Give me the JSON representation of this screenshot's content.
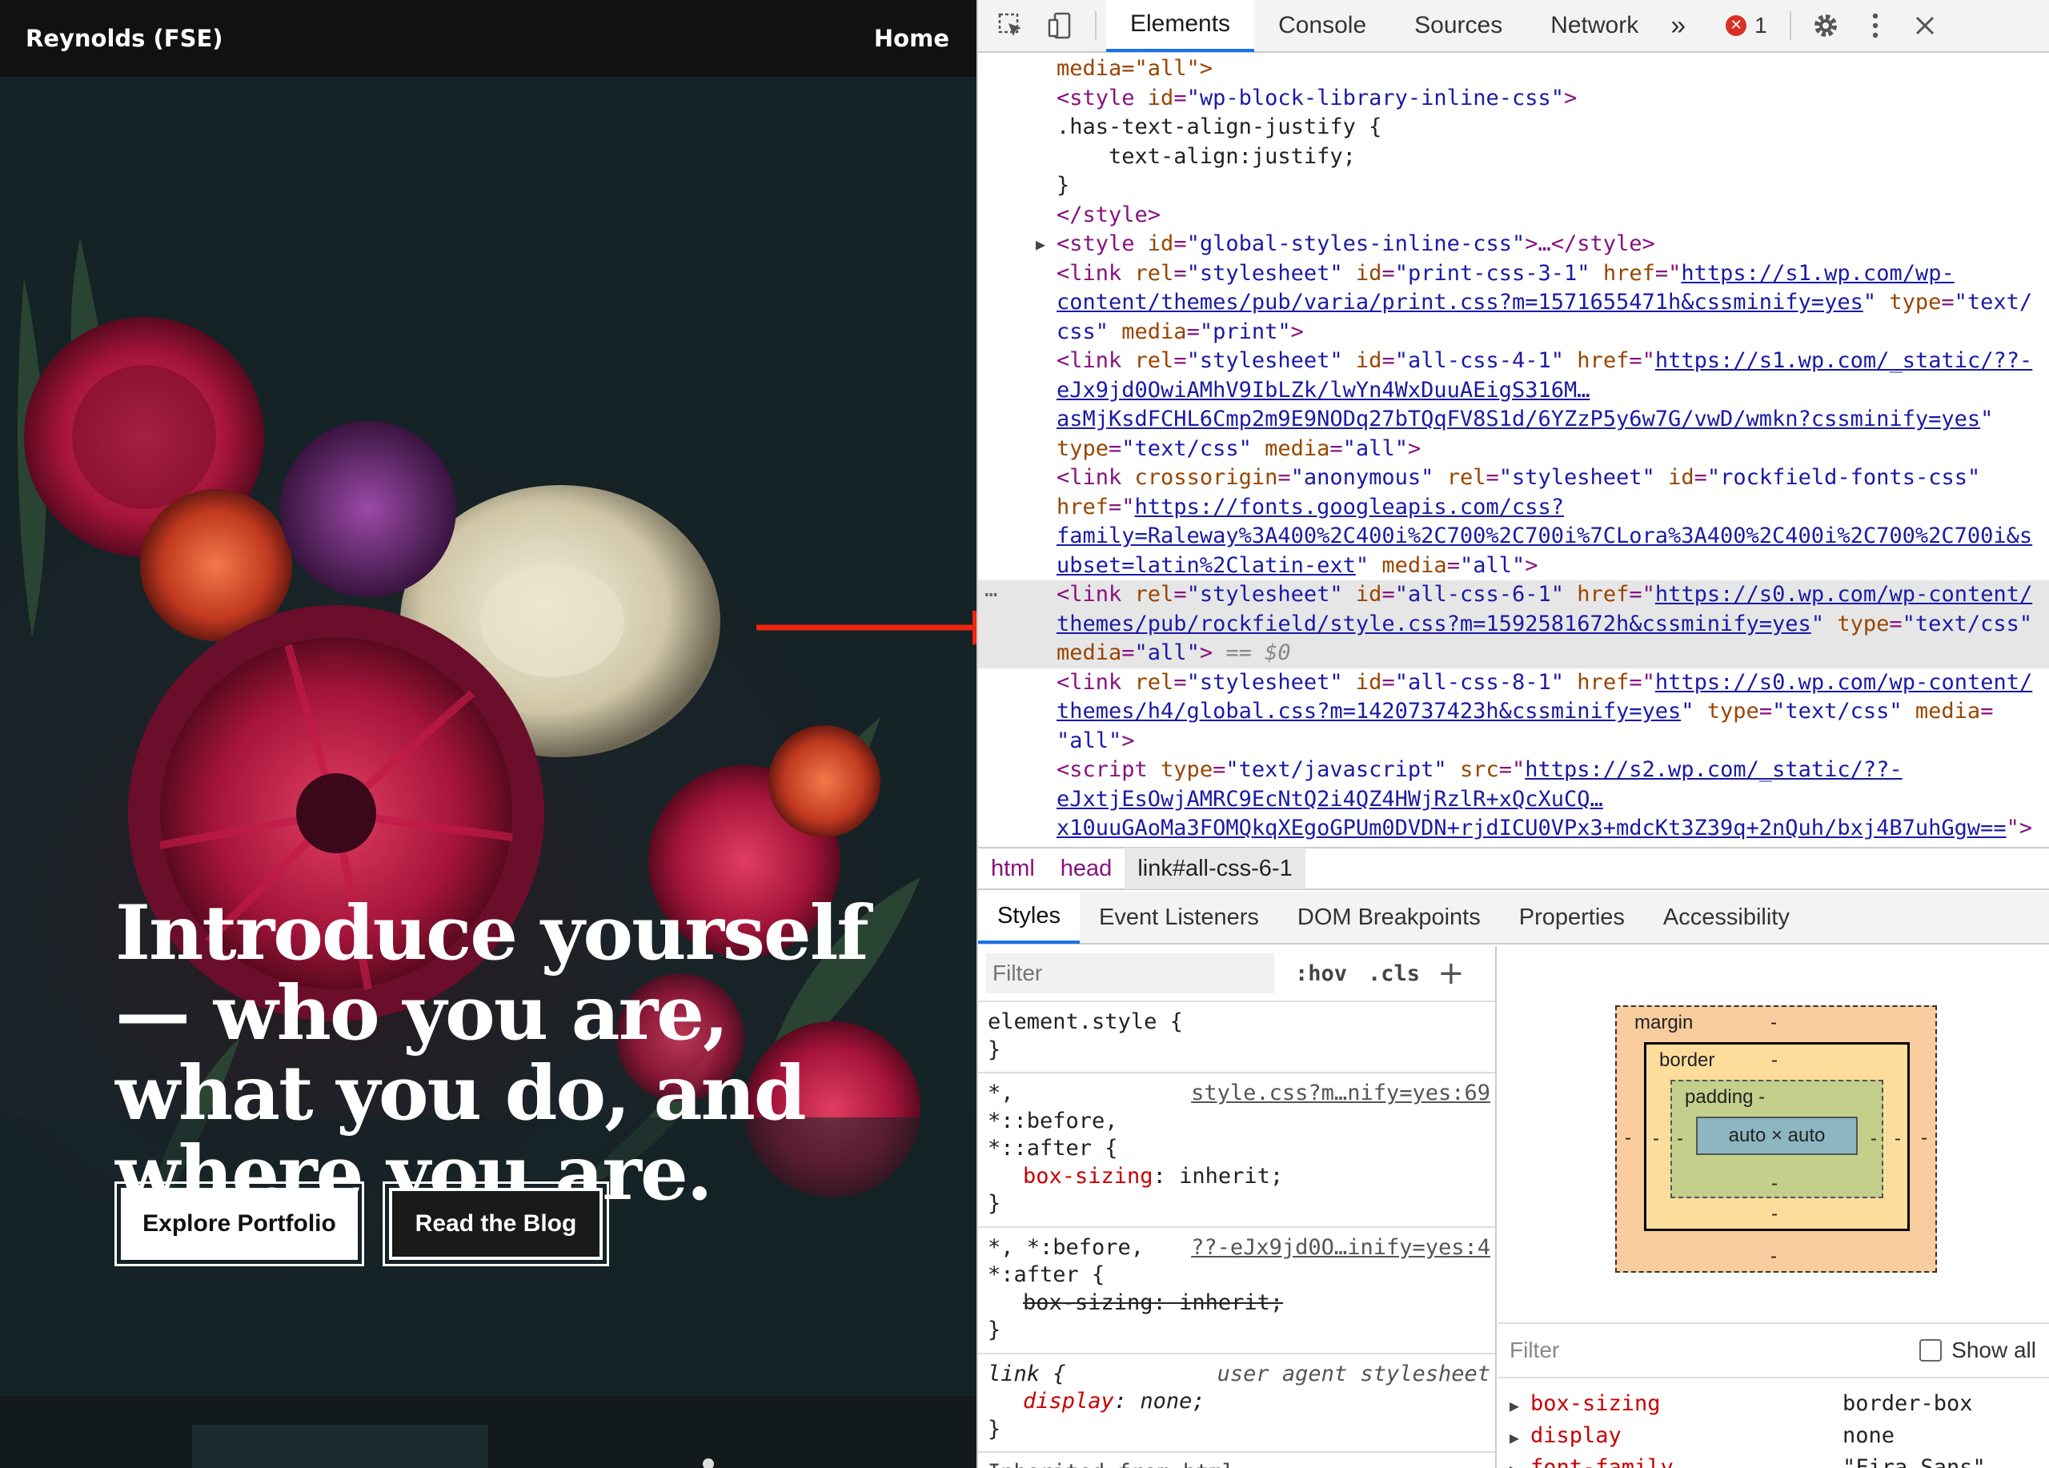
{
  "site": {
    "title": "Reynolds (FSE)",
    "nav_home": "Home",
    "hero_heading": "Introduce yourself — who you are, what you do, and where you are.",
    "button_portfolio": "Explore Portfolio",
    "button_blog": "Read the Blog"
  },
  "devtools": {
    "tabs": [
      "Elements",
      "Console",
      "Sources",
      "Network"
    ],
    "tab_more": "»",
    "error_count": "1",
    "dom_lines": {
      "l1": "media=\"all\">",
      "l2_tag": "<style ",
      "l2_attr": "id",
      "l2_val": "\"wp-block-library-inline-css\"",
      "l2_end": ">",
      "l3": ".has-text-align-justify {",
      "l4": "    text-align:justify;",
      "l5": "}",
      "l6": "</style>",
      "l7_tag": "<style ",
      "l7_attr": "id",
      "l7_val": "\"global-styles-inline-css\"",
      "l7_end": ">…</style>",
      "l8_a": "<link ",
      "l8_b": "rel",
      "l8_c": "\"stylesheet\"",
      "l8_d": " id",
      "l8_e": "\"print-css-3-1\"",
      "l8_f": " href",
      "l8_link": "https://s1.wp.com/wp-",
      "l9_link": "content/themes/pub/varia/print.css?m=1571655471h&cssminify=yes",
      "l9_b": " type",
      "l9_c": "\"text/",
      "l10_a": "css\"",
      "l10_b": " media",
      "l10_c": "\"print\"",
      "l10_d": ">",
      "l11_a": "<link ",
      "l11_b": "rel",
      "l11_c": "\"stylesheet\"",
      "l11_d": " id",
      "l11_e": "\"all-css-4-1\"",
      "l11_f": " href",
      "l11_link": "https://s1.wp.com/_static/??-",
      "l12_link": "eJx9jd0OwiAMhV9IbLZk/lwYn4WxDuuAEigS316M…",
      "l13_link": "asMjKsdFCHL6Cmp2m9E9NODq27bTQqFV8S1d/6YZzP5y6w7G/vwD/wmkn?cssminify=yes",
      "l14_a": "type",
      "l14_b": "\"text/css\"",
      "l14_c": " media",
      "l14_d": "\"all\"",
      "l14_e": ">",
      "l15_a": "<link ",
      "l15_b": "crossorigin",
      "l15_c": "\"anonymous\"",
      "l15_d": " rel",
      "l15_e": "\"stylesheet\"",
      "l15_f": " id",
      "l15_g": "\"rockfield-fonts-css\"",
      "l16_a": "href",
      "l16_link": "https://fonts.googleapis.com/css?",
      "l17_link": "family=Raleway%3A400%2C400i%2C700%2C700i%7CLora%3A400%2C400i%2C700%2C700i&s",
      "l18_link": "ubset=latin%2Clatin-ext",
      "l18_b": " media",
      "l18_c": "\"all\"",
      "l18_d": ">",
      "l19_a": "<link ",
      "l19_b": "rel",
      "l19_c": "\"stylesheet\"",
      "l19_d": " id",
      "l19_e": "\"all-css-6-1\"",
      "l19_f": " href",
      "l19_link": "https://s0.wp.com/wp-content/",
      "l20_link": "themes/pub/rockfield/style.css?m=1592581672h&cssminify=yes",
      "l20_b": " type",
      "l20_c": "\"text/css\"",
      "l21_a": "media",
      "l21_b": "\"all\"",
      "l21_c": ">",
      "l21_d": " == $0",
      "l22_a": "<link ",
      "l22_b": "rel",
      "l22_c": "\"stylesheet\"",
      "l22_d": " id",
      "l22_e": "\"all-css-8-1\"",
      "l22_f": " href",
      "l22_link": "https://s0.wp.com/wp-content/",
      "l23_link": "themes/h4/global.css?m=1420737423h&cssminify=yes",
      "l23_b": " type",
      "l23_c": "\"text/css\"",
      "l23_d": " media",
      "l24_a": "\"all\"",
      "l24_b": ">",
      "l25_a": "<script ",
      "l25_b": "type",
      "l25_c": "\"text/javascript\"",
      "l25_d": " src",
      "l25_link": "https://s2.wp.com/_static/??-",
      "l26_link": "eJxtjEsOwjAMRC9EcNtQ2i4QZ4HWjRzlR+xQcXuCQ…",
      "l27_link": "x10uuGAoMa3FOMQkqXEgoGPUm0DVDN+rjdICU0VPx3+mdcKt3Z39q+2nQuh/bxj4B7uhGgw==",
      "l27_b": "\">"
    },
    "breadcrumb": [
      "html",
      "head",
      "link#all-css-6-1"
    ],
    "sub_tabs": [
      "Styles",
      "Event Listeners",
      "DOM Breakpoints",
      "Properties",
      "Accessibility"
    ],
    "styles": {
      "filter_placeholder": "Filter",
      "hov": ":hov",
      "cls": ".cls",
      "plus": "+",
      "rule1_sel": "element.style {",
      "rule1_end": "}",
      "rule2_sel1": "*,",
      "rule2_sel2": "*::before,",
      "rule2_sel3": "*::after {",
      "rule2_src": "style.css?m…nify=yes:69",
      "rule2_prop": "box-sizing",
      "rule2_val": "inherit;",
      "rule2_end": "}",
      "rule3_sel1": "*, *:before,",
      "rule3_sel2": "*:after {",
      "rule3_src": "??-eJx9jd0O…inify=yes:4",
      "rule3_decl": "box-sizing: inherit;",
      "rule3_end": "}",
      "rule4_sel": "link {",
      "rule4_src": "user agent stylesheet",
      "rule4_prop": "display",
      "rule4_val": "none;",
      "rule4_end": "}",
      "inherited": "Inherited from html"
    },
    "boxmodel": {
      "margin_label": "margin",
      "border_label": "border",
      "padding_label": "padding -",
      "dash": "-",
      "content": "auto × auto"
    },
    "computed": {
      "filter_placeholder": "Filter",
      "show_all": "Show all",
      "rows": [
        {
          "k": "box-sizing",
          "v": "border-box"
        },
        {
          "k": "display",
          "v": "none"
        },
        {
          "k": "font-family",
          "v": "\"Fira Sans\""
        }
      ]
    }
  }
}
